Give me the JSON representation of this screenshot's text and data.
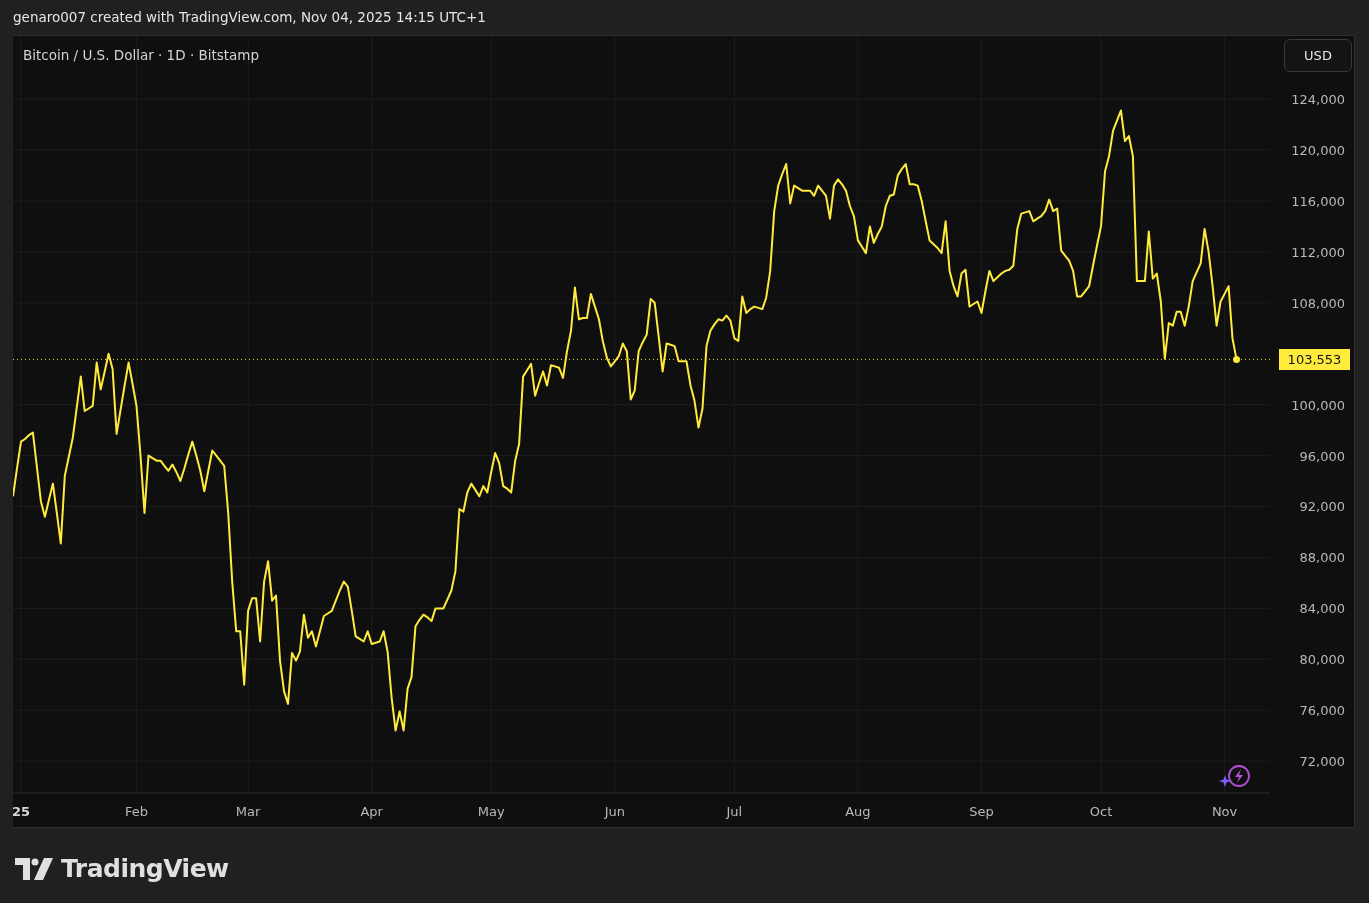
{
  "header": {
    "caption": "genaro007 created with TradingView.com, Nov 04, 2025 14:15 UTC+1"
  },
  "chart": {
    "legend": "Bitcoin / U.S. Dollar · 1D · Bitstamp",
    "currency_button": "USD",
    "chart_data": {
      "type": "line",
      "grid": true,
      "ref_lines": [
        {
          "axis": "y",
          "value": 103553,
          "label": "103,553",
          "color": "#ffeb3b"
        }
      ],
      "categories": [
        null,
        null,
        "25",
        null,
        null,
        null,
        null,
        null,
        null,
        null,
        null,
        null,
        null,
        null,
        null,
        null,
        null,
        null,
        null,
        null,
        null,
        null,
        null,
        null,
        null,
        null,
        null,
        null,
        null,
        null,
        null,
        "Feb",
        null,
        null,
        null,
        null,
        null,
        null,
        null,
        null,
        null,
        null,
        null,
        null,
        null,
        null,
        null,
        null,
        null,
        null,
        null,
        null,
        null,
        null,
        null,
        null,
        null,
        null,
        null,
        "Mar",
        null,
        null,
        null,
        null,
        null,
        null,
        null,
        null,
        null,
        null,
        null,
        null,
        null,
        null,
        null,
        null,
        null,
        null,
        null,
        null,
        null,
        null,
        null,
        null,
        null,
        null,
        null,
        null,
        null,
        null,
        "Apr",
        null,
        null,
        null,
        null,
        null,
        null,
        null,
        null,
        null,
        null,
        null,
        null,
        null,
        null,
        null,
        null,
        null,
        null,
        null,
        null,
        null,
        null,
        null,
        null,
        null,
        null,
        null,
        null,
        null,
        "May",
        null,
        null,
        null,
        null,
        null,
        null,
        null,
        null,
        null,
        null,
        null,
        null,
        null,
        null,
        null,
        null,
        null,
        null,
        null,
        null,
        null,
        null,
        null,
        null,
        null,
        null,
        null,
        null,
        null,
        null,
        "Jun",
        null,
        null,
        null,
        null,
        null,
        null,
        null,
        null,
        null,
        null,
        null,
        null,
        null,
        null,
        null,
        null,
        null,
        null,
        null,
        null,
        null,
        null,
        null,
        null,
        null,
        null,
        null,
        null,
        null,
        "Jul",
        null,
        null,
        null,
        null,
        null,
        null,
        null,
        null,
        null,
        null,
        null,
        null,
        null,
        null,
        null,
        null,
        null,
        null,
        null,
        null,
        null,
        null,
        null,
        null,
        null,
        null,
        null,
        null,
        null,
        null,
        "Aug",
        null,
        null,
        null,
        null,
        null,
        null,
        null,
        null,
        null,
        null,
        null,
        null,
        null,
        null,
        null,
        null,
        null,
        null,
        null,
        null,
        null,
        null,
        null,
        null,
        null,
        null,
        null,
        null,
        null,
        null,
        "Sep",
        null,
        null,
        null,
        null,
        null,
        null,
        null,
        null,
        null,
        null,
        null,
        null,
        null,
        null,
        null,
        null,
        null,
        null,
        null,
        null,
        null,
        null,
        null,
        null,
        null,
        null,
        null,
        null,
        null,
        "Oct",
        null,
        null,
        null,
        null,
        null,
        null,
        null,
        null,
        null,
        null,
        null,
        null,
        null,
        null,
        null,
        null,
        null,
        null,
        null,
        null,
        null,
        null,
        null,
        null,
        null,
        null,
        null,
        null,
        null,
        null,
        "Nov",
        null,
        null,
        null,
        null,
        null,
        null,
        null,
        null,
        null,
        null,
        null
      ],
      "series": [
        {
          "color": "#ffeb3b",
          "values": [
            92800,
            95000,
            97100,
            97300,
            97600,
            97800,
            95100,
            92400,
            91200,
            92500,
            93800,
            91500,
            89100,
            94400,
            95900,
            97400,
            99800,
            102200,
            99500,
            99700,
            99900,
            103300,
            101200,
            102600,
            104000,
            102800,
            97700,
            99600,
            101500,
            103300,
            101600,
            99900,
            96000,
            91500,
            96000,
            95800,
            95600,
            95600,
            95200,
            94800,
            95300,
            94700,
            94000,
            95000,
            96100,
            97100,
            96000,
            94800,
            93200,
            94800,
            96400,
            96000,
            95600,
            95200,
            91500,
            86100,
            82200,
            82200,
            78000,
            83800,
            84800,
            84800,
            81400,
            86100,
            87700,
            84600,
            85000,
            79900,
            77500,
            76500,
            80500,
            79900,
            80600,
            83500,
            81700,
            82200,
            81000,
            82200,
            83400,
            83600,
            83800,
            84600,
            85400,
            86100,
            85700,
            83800,
            81800,
            81600,
            81400,
            82200,
            81200,
            81300,
            81400,
            82200,
            80600,
            77000,
            74400,
            75900,
            74400,
            77700,
            78600,
            82600,
            83100,
            83500,
            83300,
            83000,
            84000,
            84000,
            84000,
            84700,
            85400,
            86900,
            91800,
            91600,
            93100,
            93800,
            93300,
            92800,
            93600,
            93100,
            94700,
            96200,
            95400,
            93600,
            93400,
            93100,
            95600,
            96900,
            102200,
            102700,
            103200,
            100700,
            101700,
            102600,
            101500,
            103100,
            103000,
            102900,
            102100,
            104200,
            105800,
            109200,
            106700,
            106800,
            106800,
            108700,
            107700,
            106700,
            105000,
            103700,
            103000,
            103400,
            103800,
            104800,
            104200,
            100400,
            101100,
            104200,
            104900,
            105500,
            108300,
            108000,
            105400,
            102600,
            104800,
            104700,
            104600,
            103400,
            103400,
            103400,
            101500,
            100300,
            98200,
            99700,
            104600,
            105800,
            106300,
            106700,
            106600,
            107000,
            106600,
            105200,
            105000,
            108500,
            107200,
            107500,
            107700,
            107600,
            107500,
            108400,
            110500,
            115200,
            117200,
            118100,
            118900,
            115800,
            117200,
            117000,
            116800,
            116800,
            116800,
            116400,
            117200,
            116800,
            116400,
            114600,
            117200,
            117700,
            117300,
            116800,
            115600,
            114800,
            112900,
            112400,
            111900,
            114000,
            112700,
            113400,
            114000,
            115600,
            116400,
            116500,
            118000,
            118500,
            118900,
            117300,
            117300,
            117200,
            116000,
            114400,
            112900,
            112600,
            112300,
            111900,
            114400,
            110500,
            109300,
            108500,
            110300,
            110600,
            107700,
            107900,
            108100,
            107200,
            108900,
            110500,
            109700,
            110000,
            110300,
            110500,
            110600,
            110900,
            113800,
            115000,
            115100,
            115200,
            114400,
            114600,
            114800,
            115200,
            116100,
            115200,
            115400,
            112100,
            111700,
            111300,
            110500,
            108500,
            108500,
            108900,
            109300,
            110900,
            112500,
            114000,
            118300,
            119500,
            121500,
            122300,
            123100,
            120700,
            121100,
            119500,
            109700,
            109700,
            109700,
            113600,
            109900,
            110300,
            108100,
            103600,
            106400,
            106200,
            107300,
            107300,
            106200,
            107700,
            109700,
            110400,
            111100,
            113800,
            112000,
            109300,
            106200,
            108100,
            108700,
            109300,
            105200,
            103553,
            null,
            null,
            null,
            null,
            null,
            null,
            null,
            null
          ]
        }
      ],
      "ylim": [
        69500,
        128950
      ],
      "yticks": [
        {
          "value": 72000,
          "label": "72,000"
        },
        {
          "value": 76000,
          "label": "76,000"
        },
        {
          "value": 80000,
          "label": "80,000"
        },
        {
          "value": 84000,
          "label": "84,000"
        },
        {
          "value": 88000,
          "label": "88,000"
        },
        {
          "value": 92000,
          "label": "92,000"
        },
        {
          "value": 96000,
          "label": "96,000"
        },
        {
          "value": 100000,
          "label": "100,000"
        },
        {
          "value": 108000,
          "label": "108,000"
        },
        {
          "value": 112000,
          "label": "112,000"
        },
        {
          "value": 116000,
          "label": "116,000"
        },
        {
          "value": 120000,
          "label": "120,000"
        },
        {
          "value": 124000,
          "label": "124,000"
        }
      ]
    }
  },
  "footer": {
    "logo_text": "TradingView"
  }
}
